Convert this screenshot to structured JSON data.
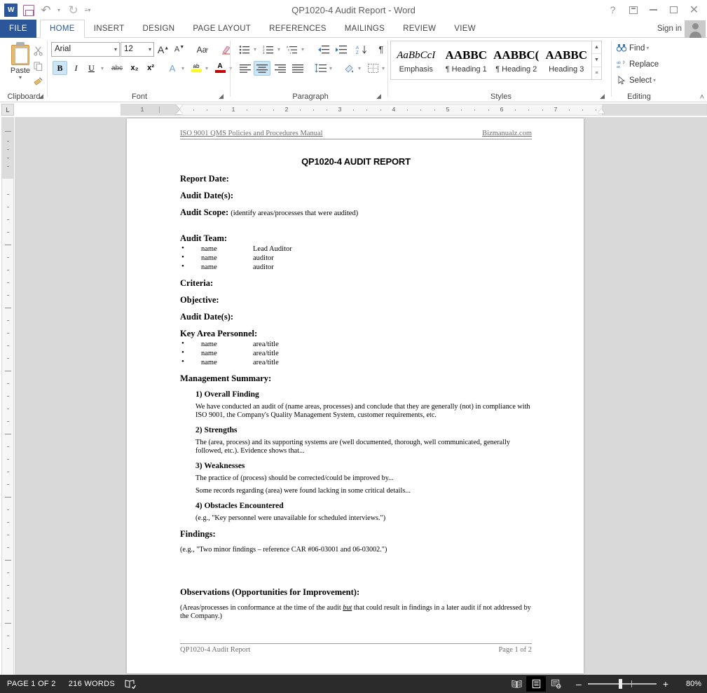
{
  "window": {
    "title": "QP1020-4 Audit Report - Word",
    "help_icon": "?",
    "ribbon_display_icon": "ribbon-display-options",
    "minimize_icon": "minimize",
    "restore_icon": "restore",
    "close_icon": "✕",
    "sign_in": "Sign in"
  },
  "qat": {
    "app_logo": "W",
    "save_title": "Save",
    "undo_glyph": "↶",
    "redo_glyph": "↻",
    "customize_glyph": "≡"
  },
  "tabs": [
    {
      "label": "FILE",
      "active": false,
      "file": true
    },
    {
      "label": "HOME",
      "active": true
    },
    {
      "label": "INSERT",
      "active": false
    },
    {
      "label": "DESIGN",
      "active": false
    },
    {
      "label": "PAGE LAYOUT",
      "active": false
    },
    {
      "label": "REFERENCES",
      "active": false
    },
    {
      "label": "MAILINGS",
      "active": false
    },
    {
      "label": "REVIEW",
      "active": false
    },
    {
      "label": "VIEW",
      "active": false
    }
  ],
  "ribbon": {
    "collapse_glyph": "˄",
    "groups": {
      "clipboard": {
        "label": "Clipboard",
        "paste_label": "Paste",
        "paste_caret": "▾",
        "cut_name": "cut-icon",
        "copy_name": "copy-icon",
        "format_painter_name": "format-painter-icon",
        "launcher": "⤵"
      },
      "font": {
        "label": "Font",
        "font_name": "Arial",
        "font_size": "12",
        "grow_font": "A",
        "shrink_font": "A",
        "change_case": "Aa",
        "clear_formatting": "clear-formatting-icon",
        "bold": "B",
        "italic": "I",
        "underline": "U",
        "strikethrough": "abc",
        "subscript": "x₂",
        "superscript": "x²",
        "text_effects": "A",
        "highlight": "ab",
        "font_color": "A",
        "launcher": "⤵",
        "caret": "▾"
      },
      "paragraph": {
        "label": "Paragraph",
        "bullets": "bullets-icon",
        "numbering": "numbering-icon",
        "multilevel": "multilevel-list-icon",
        "decrease_indent": "decrease-indent-icon",
        "increase_indent": "increase-indent-icon",
        "sort": "sort-icon",
        "show_marks": "¶",
        "align_left": "align-left-icon",
        "align_center": "align-center-icon",
        "align_right": "align-right-icon",
        "justify": "justify-icon",
        "line_spacing": "line-spacing-icon",
        "shading": "shading-icon",
        "borders": "borders-icon",
        "launcher": "⤵",
        "caret": "▾"
      },
      "styles": {
        "label": "Styles",
        "launcher": "⤵",
        "scroll_up": "▲",
        "scroll_down": "▼",
        "more": "≡",
        "items": [
          {
            "preview": "AaBbCcI",
            "name": "Emphasis",
            "style": "em"
          },
          {
            "preview": "AABBC",
            "name": "¶ Heading 1",
            "style": "bold"
          },
          {
            "preview": "AABBC(",
            "name": "¶ Heading 2",
            "style": "bold"
          },
          {
            "preview": "AABBC",
            "name": "Heading 3",
            "style": "bold"
          }
        ]
      },
      "editing": {
        "label": "Editing",
        "find": "Find",
        "find_caret": "▾",
        "replace": "Replace",
        "select": "Select",
        "select_caret": "▾"
      }
    }
  },
  "ruler": {
    "corner_tabstop": "L",
    "h_numbers": [
      "1",
      "2",
      "3",
      "4",
      "5",
      "6",
      "7"
    ]
  },
  "document": {
    "header_left": "ISO 9001 QMS Policies and Procedures Manual",
    "header_right": "Bizmanualz.com",
    "footer_left": "QP1020-4 Audit Report",
    "footer_right": "Page 1 of 2",
    "title": "QP1020-4 AUDIT REPORT",
    "fields": {
      "report_date": "Report Date:",
      "audit_dates_1": "Audit Date(s):",
      "audit_scope_label": "Audit Scope:",
      "audit_scope_note": "(identify areas/processes that were audited)",
      "audit_team": "Audit Team:",
      "criteria": "Criteria:",
      "objective": "Objective:",
      "audit_dates_2": "Audit Date(s):",
      "key_area_personnel": "Key Area Personnel:",
      "management_summary": "Management Summary:",
      "findings": "Findings:",
      "observations": "Observations (Opportunities for Improvement):"
    },
    "audit_team_rows": [
      {
        "name": "name",
        "role": "Lead Auditor"
      },
      {
        "name": "name",
        "role": "auditor"
      },
      {
        "name": "name",
        "role": "auditor"
      }
    ],
    "key_area_rows": [
      {
        "name": "name",
        "role": "area/title"
      },
      {
        "name": "name",
        "role": "area/title"
      },
      {
        "name": "name",
        "role": "area/title"
      }
    ],
    "summary_sections": [
      {
        "heading": "1) Overall Finding",
        "paras": [
          "We have conducted an audit of (name areas, processes) and conclude that they are generally (not) in compliance with ISO 9001, the Company's Quality Management System, customer requirements, etc."
        ]
      },
      {
        "heading": "2) Strengths",
        "paras": [
          "The (area, process) and its supporting systems are (well documented, thorough, well communicated, generally followed, etc.).  Evidence shows that..."
        ]
      },
      {
        "heading": "3) Weaknesses",
        "paras": [
          "The practice of (process) should be corrected/could be improved by...",
          "Some records regarding (area) were found lacking in some critical details..."
        ]
      },
      {
        "heading": "4) Obstacles Encountered",
        "paras": [
          "(e.g., \"Key personnel were unavailable for scheduled interviews.\")"
        ]
      }
    ],
    "findings_text": "(e.g., \"Two minor findings – reference CAR #06-03001 and 06-03002.\")",
    "observations_text_a": "(Areas/processes in conformance at the time of the audit ",
    "observations_text_italic": "but",
    "observations_text_b": " that could result in findings in a later audit if not addressed by the Company.)"
  },
  "statusbar": {
    "page_count": "PAGE 1 OF 2",
    "word_count": "216 WORDS",
    "proofing_icon": "proofing-errors-icon",
    "read_mode_icon": "read-mode-icon",
    "print_layout_icon": "print-layout-icon",
    "web_layout_icon": "web-layout-icon",
    "zoom_out": "–",
    "zoom_in": "+",
    "zoom_level": "80%"
  },
  "colors": {
    "word_blue": "#2b579a",
    "accent_selected": "#cde6f7",
    "statusbar_bg": "#2b2b2b",
    "page_bg": "#d9d9d9"
  }
}
